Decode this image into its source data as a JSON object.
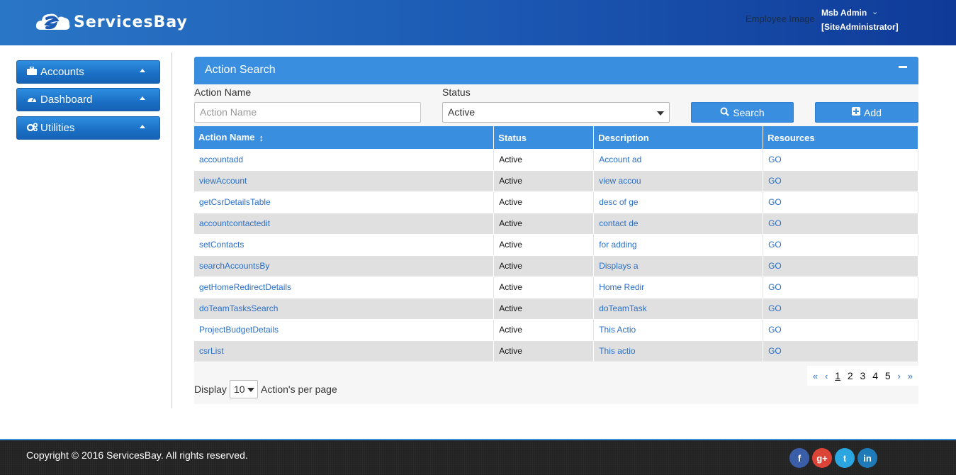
{
  "header": {
    "brand": "ServicesBay",
    "employee_image_alt": "Employee Image",
    "user_name": "Msb Admin",
    "user_role": "[SiteAdministrator]",
    "colors": {
      "gradient_start": "#2a76c6",
      "gradient_end": "#0f3a98"
    }
  },
  "sidebar": {
    "items": [
      {
        "label": "Accounts",
        "icon": "briefcase-icon"
      },
      {
        "label": "Dashboard",
        "icon": "dashboard-icon"
      },
      {
        "label": "Utilities",
        "icon": "cogs-icon"
      }
    ]
  },
  "panel": {
    "title": "Action Search",
    "accent": "#3a8ee0"
  },
  "form": {
    "action_name_label": "Action Name",
    "action_name_placeholder": "Action Name",
    "action_name_value": "",
    "status_label": "Status",
    "status_value": "Active",
    "search_label": "Search",
    "add_label": "Add"
  },
  "table": {
    "headers": [
      "Action Name",
      "Status",
      "Description",
      "Resources"
    ],
    "rows": [
      {
        "name": "accountadd",
        "status": "Active",
        "description": "Account ad",
        "resource": "GO"
      },
      {
        "name": "viewAccount",
        "status": "Active",
        "description": "view accou",
        "resource": "GO"
      },
      {
        "name": "getCsrDetailsTable",
        "status": "Active",
        "description": "desc of ge",
        "resource": "GO"
      },
      {
        "name": "accountcontactedit",
        "status": "Active",
        "description": "contact de",
        "resource": "GO"
      },
      {
        "name": "setContacts",
        "status": "Active",
        "description": "for adding",
        "resource": "GO"
      },
      {
        "name": "searchAccountsBy",
        "status": "Active",
        "description": "Displays a",
        "resource": "GO"
      },
      {
        "name": "getHomeRedirectDetails",
        "status": "Active",
        "description": "Home Redir",
        "resource": "GO"
      },
      {
        "name": "doTeamTasksSearch",
        "status": "Active",
        "description": "doTeamTask",
        "resource": "GO"
      },
      {
        "name": "ProjectBudgetDetails",
        "status": "Active",
        "description": "This Actio",
        "resource": "GO"
      },
      {
        "name": "csrList",
        "status": "Active",
        "description": "This actio",
        "resource": "GO"
      }
    ]
  },
  "pagination": {
    "pages": [
      "1",
      "2",
      "3",
      "4",
      "5"
    ],
    "current_page": "1",
    "first": "«",
    "prev": "‹",
    "next": "›",
    "last": "»"
  },
  "per_page": {
    "display_label": "Display",
    "value": "10",
    "suffix_label": "Action's per page"
  },
  "footer": {
    "copyright": "Copyright © 2016 ServicesBay. All rights reserved.",
    "social": [
      {
        "name": "facebook",
        "glyph": "f",
        "color": "#3b5ea8"
      },
      {
        "name": "google-plus",
        "glyph": "g+",
        "color": "#db4437"
      },
      {
        "name": "twitter",
        "glyph": "t",
        "color": "#2ba6e1"
      },
      {
        "name": "linkedin",
        "glyph": "in",
        "color": "#1e7bb8"
      }
    ]
  }
}
